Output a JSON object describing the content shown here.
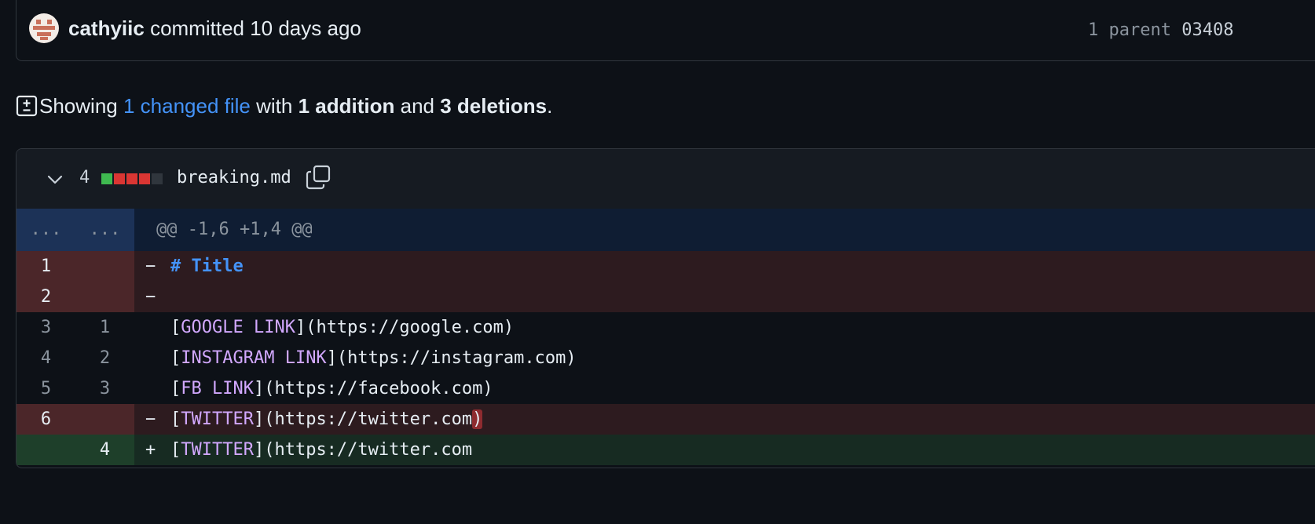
{
  "commit": {
    "author": "cathyiic",
    "action_text": "committed 10 days ago",
    "parent_label": "1 parent",
    "parent_sha": "03408"
  },
  "summary": {
    "prefix": "Showing",
    "changed_link": "1 changed file",
    "with_text": "with",
    "additions": "1 addition",
    "and_text": "and",
    "deletions": "3 deletions",
    "suffix": "."
  },
  "file": {
    "change_count": "4",
    "name": "breaking.md",
    "blocks": [
      "#3fb950",
      "#da3633",
      "#da3633",
      "#da3633",
      "#30363d"
    ]
  },
  "diff": {
    "hunk": {
      "left": "...",
      "right": "...",
      "text": "@@ -1,6 +1,4 @@"
    },
    "lines": [
      {
        "left": "1",
        "right": "",
        "sign": "−",
        "open": "",
        "label": "# Title",
        "mid": "",
        "tail": "",
        "close": ""
      },
      {
        "left": "2",
        "right": "",
        "sign": "−",
        "open": "",
        "label": "",
        "mid": "",
        "tail": "",
        "close": ""
      },
      {
        "left": "3",
        "right": "1",
        "sign": "",
        "open": "[",
        "label": "GOOGLE LINK",
        "mid": "](https://google.com)",
        "tail": "",
        "close": ""
      },
      {
        "left": "4",
        "right": "2",
        "sign": "",
        "open": "[",
        "label": "INSTAGRAM LINK",
        "mid": "](https://instagram.com)",
        "tail": "",
        "close": ""
      },
      {
        "left": "5",
        "right": "3",
        "sign": "",
        "open": "[",
        "label": "FB LINK",
        "mid": "](https://facebook.com)",
        "tail": "",
        "close": ""
      },
      {
        "left": "6",
        "right": "",
        "sign": "−",
        "open": "[",
        "label": "TWITTER",
        "mid": "](https://twitter.com",
        "tail": ")",
        "close": ""
      },
      {
        "left": "",
        "right": "4",
        "sign": "+",
        "open": "[",
        "label": "TWITTER",
        "mid": "](https://twitter.com",
        "tail": "",
        "close": ""
      }
    ]
  }
}
